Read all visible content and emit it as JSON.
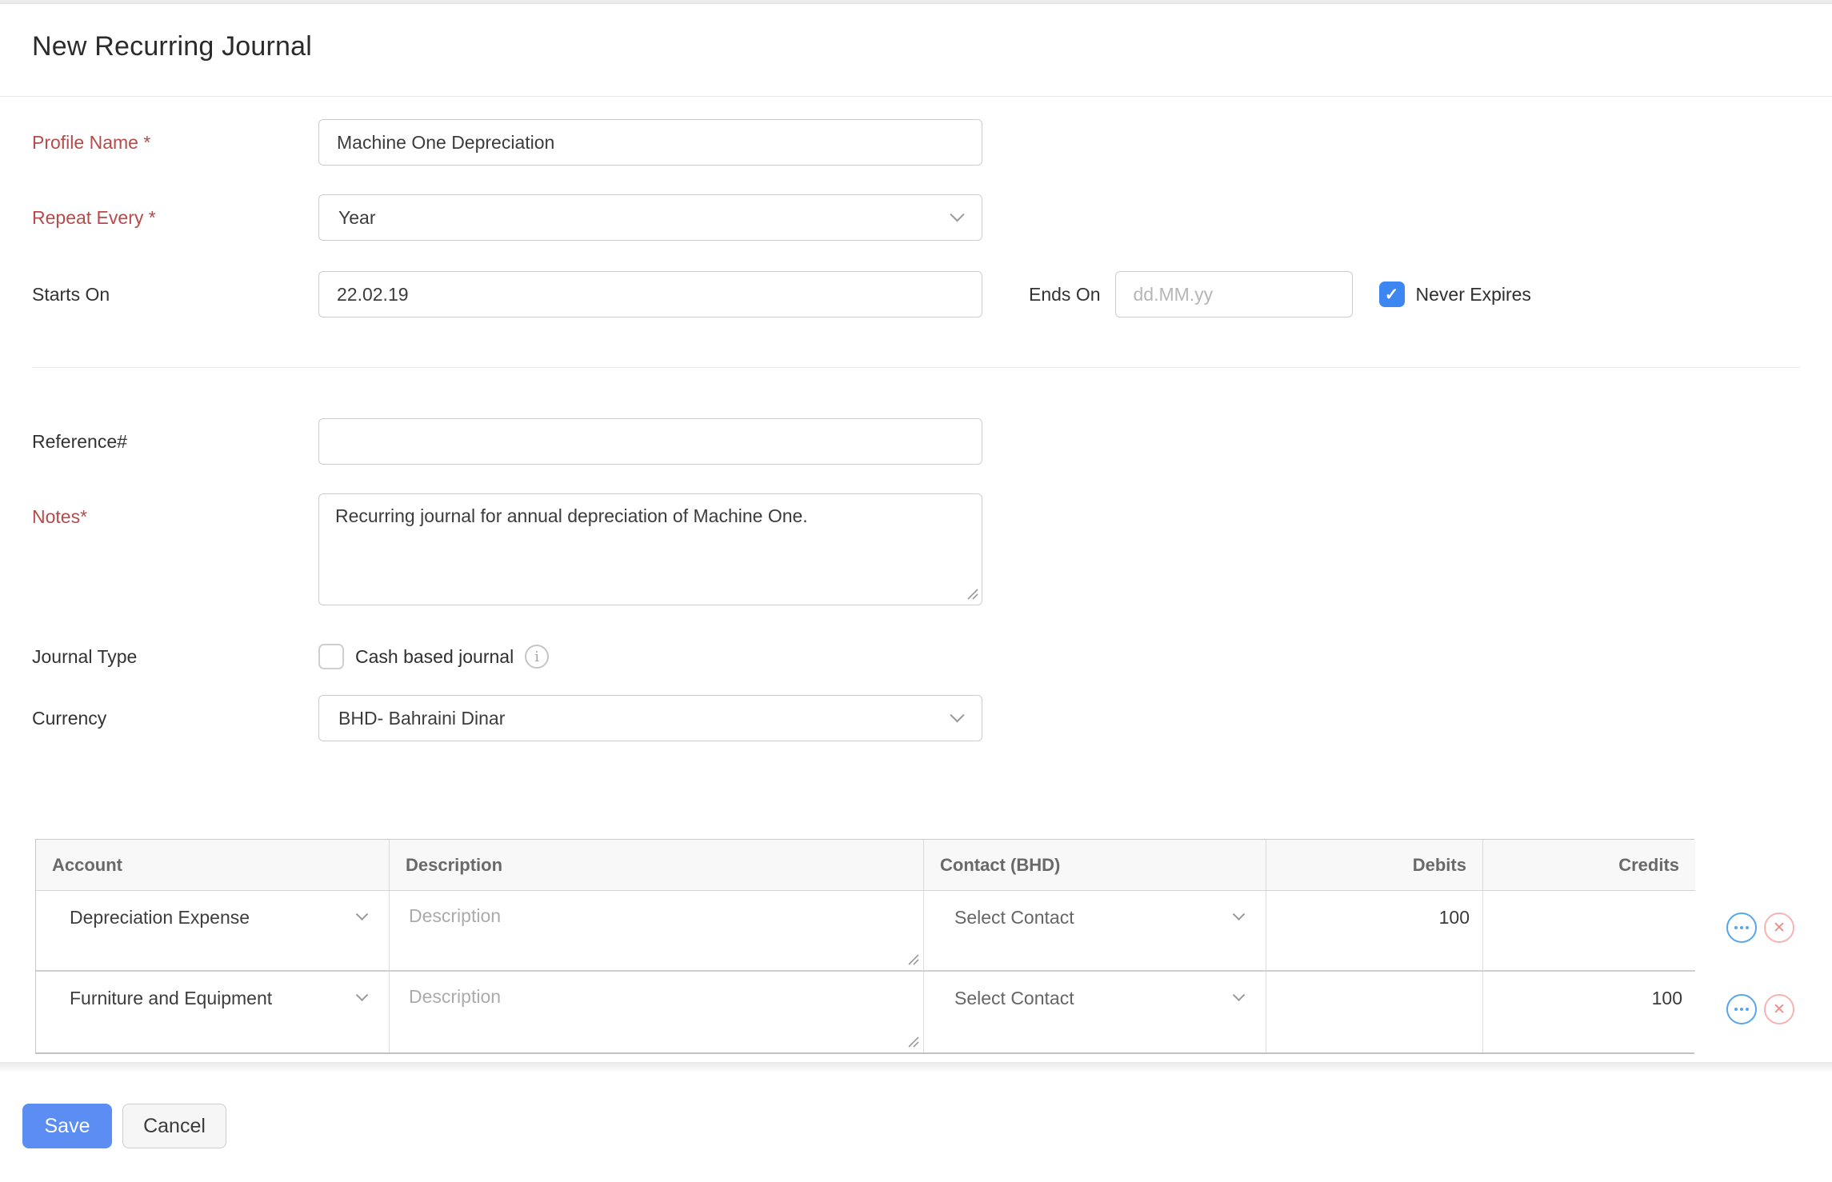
{
  "page": {
    "title": "New Recurring Journal"
  },
  "form": {
    "profile_name": {
      "label": "Profile Name *",
      "value": "Machine One Depreciation",
      "required": true
    },
    "repeat_every": {
      "label": "Repeat Every *",
      "value": "Year",
      "required": true
    },
    "starts_on": {
      "label": "Starts On",
      "value": "22.02.19"
    },
    "ends_on": {
      "label": "Ends On",
      "placeholder": "dd.MM.yy",
      "value": ""
    },
    "never_expires": {
      "label": "Never Expires",
      "checked": true
    },
    "reference": {
      "label": "Reference#",
      "value": ""
    },
    "notes": {
      "label": "Notes*",
      "value": "Recurring journal for annual depreciation of Machine One.",
      "required": true
    },
    "journal_type": {
      "label": "Journal Type",
      "checkbox_label": "Cash based journal",
      "checked": false,
      "info_icon": "info-icon"
    },
    "currency": {
      "label": "Currency",
      "value": "BHD- Bahraini Dinar"
    }
  },
  "table": {
    "headers": [
      "Account",
      "Description",
      "Contact (BHD)",
      "Debits",
      "Credits"
    ],
    "rows": [
      {
        "account": "Depreciation Expense",
        "description_placeholder": "Description",
        "contact": "Select Contact",
        "debits": "100",
        "credits": ""
      },
      {
        "account": "Furniture and Equipment",
        "description_placeholder": "Description",
        "contact": "Select Contact",
        "debits": "",
        "credits": "100"
      }
    ],
    "row_icons": [
      "ellipsis-circle-icon",
      "remove-circle-icon"
    ]
  },
  "footer": {
    "save_label": "Save",
    "cancel_label": "Cancel"
  },
  "colors": {
    "required_label_red": "#b54b4b",
    "checkbox_blue": "#3d87f3",
    "save_button_blue": "#5b8df2",
    "row_icon_blue": "#58a6ea",
    "row_icon_red": "#f6b3b3",
    "table_header_bg": "#f8f8f8"
  }
}
